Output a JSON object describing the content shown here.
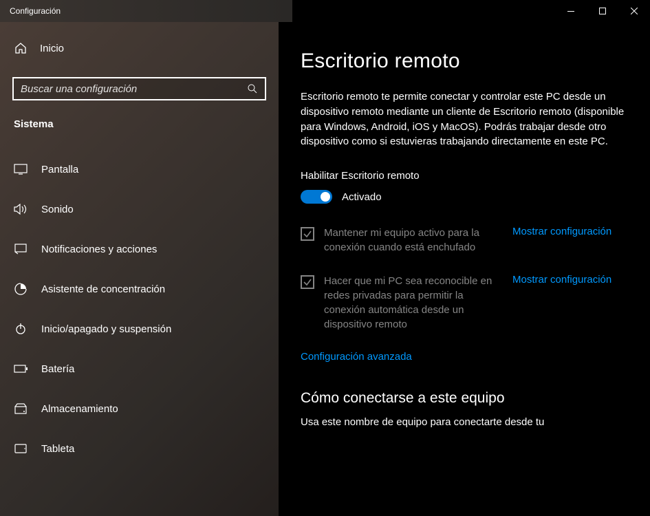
{
  "window": {
    "title": "Configuración"
  },
  "sidebar": {
    "home": "Inicio",
    "search_placeholder": "Buscar una configuración",
    "category": "Sistema",
    "items": [
      {
        "label": "Pantalla"
      },
      {
        "label": "Sonido"
      },
      {
        "label": "Notificaciones y acciones"
      },
      {
        "label": "Asistente de concentración"
      },
      {
        "label": "Inicio/apagado y suspensión"
      },
      {
        "label": "Batería"
      },
      {
        "label": "Almacenamiento"
      },
      {
        "label": "Tableta"
      }
    ]
  },
  "content": {
    "title": "Escritorio remoto",
    "description": "Escritorio remoto te permite conectar y controlar este PC desde un dispositivo remoto mediante un cliente de Escritorio remoto (disponible para Windows, Android, iOS y MacOS). Podrás trabajar desde otro dispositivo como si estuvieras trabajando directamente en este PC.",
    "enable_label": "Habilitar Escritorio remoto",
    "toggle_state": "Activado",
    "check1": "Mantener mi equipo activo para la conexión cuando está enchufado",
    "check1_link": "Mostrar configuración",
    "check2": "Hacer que mi PC sea reconocible en redes privadas para permitir la conexión automática desde un dispositivo remoto",
    "check2_link": "Mostrar configuración",
    "advanced_link": "Configuración avanzada",
    "subheading": "Cómo conectarse a este equipo",
    "cutoff": "Usa este nombre de equipo para conectarte desde tu"
  }
}
